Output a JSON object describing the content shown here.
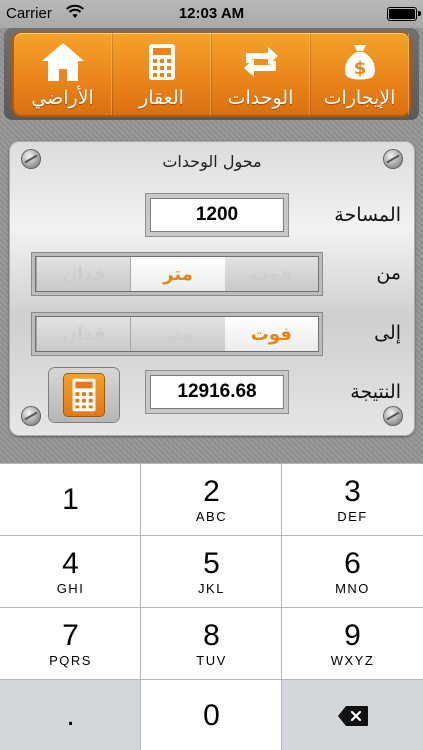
{
  "status_bar": {
    "carrier": "Carrier",
    "time": "12:03 AM"
  },
  "nav": {
    "items": [
      {
        "label": "الإيجارات",
        "icon": "money-bag-icon"
      },
      {
        "label": "الوحدات",
        "icon": "convert-arrows-icon"
      },
      {
        "label": "العقار",
        "icon": "calculator-icon"
      },
      {
        "label": "الأراضي",
        "icon": "home-icon"
      }
    ]
  },
  "panel": {
    "title": "محول الوحدات",
    "area_label": "المساحة",
    "area_value": "1200",
    "from_label": "من",
    "from_options": [
      {
        "label": "فوت",
        "selected": false
      },
      {
        "label": "متر",
        "selected": true
      },
      {
        "label": "فدان",
        "selected": false
      }
    ],
    "to_label": "إلى",
    "to_options": [
      {
        "label": "فوت",
        "selected": true
      },
      {
        "label": "متر",
        "selected": false
      },
      {
        "label": "فدان",
        "selected": false
      }
    ],
    "result_label": "النتيجة",
    "result_value": "12916.68"
  },
  "keypad": {
    "keys": [
      {
        "num": "1",
        "letters": ""
      },
      {
        "num": "2",
        "letters": "ABC"
      },
      {
        "num": "3",
        "letters": "DEF"
      },
      {
        "num": "4",
        "letters": "GHI"
      },
      {
        "num": "5",
        "letters": "JKL"
      },
      {
        "num": "6",
        "letters": "MNO"
      },
      {
        "num": "7",
        "letters": "PQRS"
      },
      {
        "num": "8",
        "letters": "TUV"
      },
      {
        "num": "9",
        "letters": "WXYZ"
      },
      {
        "num": ".",
        "letters": ""
      },
      {
        "num": "0",
        "letters": ""
      }
    ]
  },
  "colors": {
    "accent_orange": "#e58514",
    "nav_orange": "#f6a32a"
  }
}
